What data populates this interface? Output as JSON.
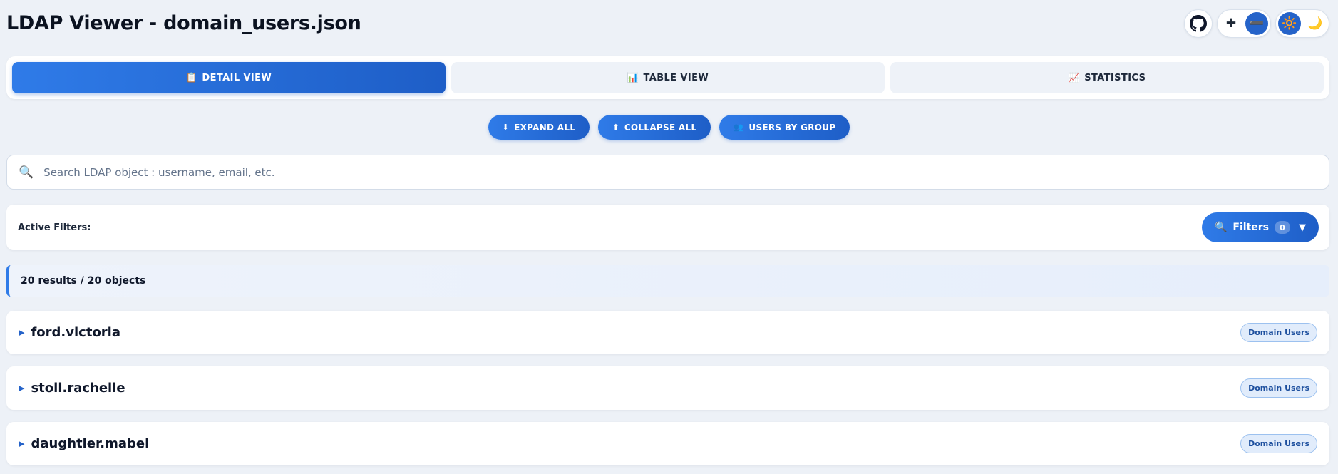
{
  "app": {
    "title": "LDAP Viewer - domain_users.json"
  },
  "header": {
    "github_icon": "github-icon",
    "zoom_in_icon": "plus-icon",
    "zoom_out_icon": "minus-icon",
    "zoom_in_label": "✚",
    "zoom_out_label": "➖",
    "light_mode_label": "🔆",
    "dark_mode_label": "🌙",
    "active_theme": "light"
  },
  "tabs": [
    {
      "icon": "📋",
      "label": "DETAIL VIEW",
      "active": true
    },
    {
      "icon": "📊",
      "label": "TABLE VIEW",
      "active": false
    },
    {
      "icon": "📈",
      "label": "STATISTICS",
      "active": false
    }
  ],
  "actions": [
    {
      "icon": "⬇",
      "label": "EXPAND ALL"
    },
    {
      "icon": "⬆",
      "label": "COLLAPSE ALL"
    },
    {
      "icon": "👥",
      "label": "USERS BY GROUP"
    }
  ],
  "search": {
    "icon": "🔍",
    "placeholder": "Search LDAP object : username, email, etc.",
    "value": ""
  },
  "filters": {
    "label": "Active Filters:",
    "button_icon": "🔍",
    "button_label": "Filters",
    "count": "0",
    "caret": "▼"
  },
  "results": {
    "summary": "20 results / 20 objects"
  },
  "objects": [
    {
      "name": "ford.victoria",
      "group": "Domain Users",
      "caret": "▶"
    },
    {
      "name": "stoll.rachelle",
      "group": "Domain Users",
      "caret": "▶"
    },
    {
      "name": "daughtler.mabel",
      "group": "Domain Users",
      "caret": "▶"
    }
  ],
  "colors": {
    "accent": "#2563c9",
    "background": "#edf1f7",
    "badge_bg": "#e1ecfb"
  }
}
